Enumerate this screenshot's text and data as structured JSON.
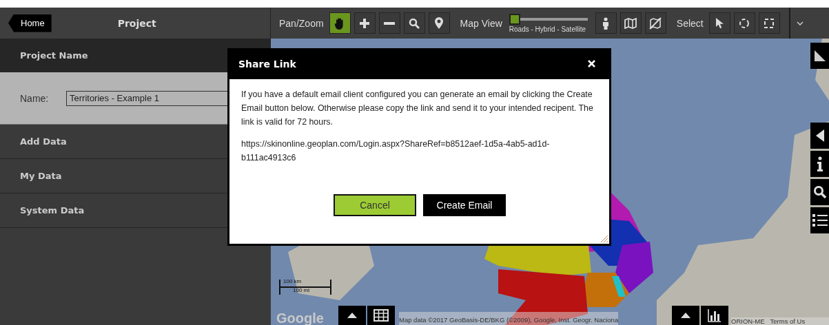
{
  "header": {
    "home_button": "Home",
    "title": "Project"
  },
  "toolbar": {
    "pan_zoom": {
      "label": "Pan/Zoom",
      "tools": [
        {
          "kind": "hand",
          "selected": true
        },
        {
          "kind": "plus",
          "selected": false
        },
        {
          "kind": "minus",
          "selected": false
        },
        {
          "kind": "search",
          "selected": false
        },
        {
          "kind": "pin",
          "selected": false
        }
      ]
    },
    "map_view": {
      "label": "Map View",
      "slider": {
        "level": 0,
        "caption": "Roads - Hybrid - Satellite"
      },
      "tools": [
        {
          "kind": "figure",
          "selected": false
        },
        {
          "kind": "map",
          "selected": false
        },
        {
          "kind": "no-map",
          "selected": false
        }
      ]
    },
    "select": {
      "label": "Select",
      "tools": [
        {
          "kind": "cursor",
          "selected": false
        },
        {
          "kind": "circle",
          "selected": false
        },
        {
          "kind": "rectangle",
          "selected": false
        }
      ]
    }
  },
  "sidebar": {
    "section_title": "Project Name",
    "name_label": "Name:",
    "name_value": "Territories - Example 1",
    "items": [
      {
        "label": "Add Data"
      },
      {
        "label": "My Data"
      },
      {
        "label": "System Data"
      }
    ]
  },
  "map": {
    "scale": {
      "km": "100 km",
      "mi": "100 mi"
    },
    "logo": "Google",
    "attribution": "Map data ©2017 GeoBasis-DE/BKG (©2009), Google, Inst. Geogr. Naciona",
    "attribution_right": [
      "ORION-ME",
      "Terms of Us"
    ],
    "side_tools": [
      {
        "kind": "triangle"
      },
      {
        "kind": "back"
      },
      {
        "kind": "info"
      },
      {
        "kind": "search"
      },
      {
        "kind": "list"
      }
    ],
    "bottom_tools": [
      {
        "kind": "up"
      },
      {
        "kind": "grid"
      },
      {
        "kind": "up"
      },
      {
        "kind": "chart"
      }
    ]
  },
  "modal": {
    "title": "Share Link",
    "message": "If you have a default email client configured you can generate an email by clicking the Create Email button below. Otherwise please copy the link and send it to your intended recipent. The link is valid for 72 hours.",
    "link": "https://skinonline.geoplan.com/Login.aspx?ShareRef=b8512aef-1d5a-4ab5-ad1d-b111ac4913c6",
    "buttons": [
      {
        "label": "Cancel",
        "kind": "secondary"
      },
      {
        "label": "Create Email",
        "kind": "primary"
      }
    ]
  }
}
